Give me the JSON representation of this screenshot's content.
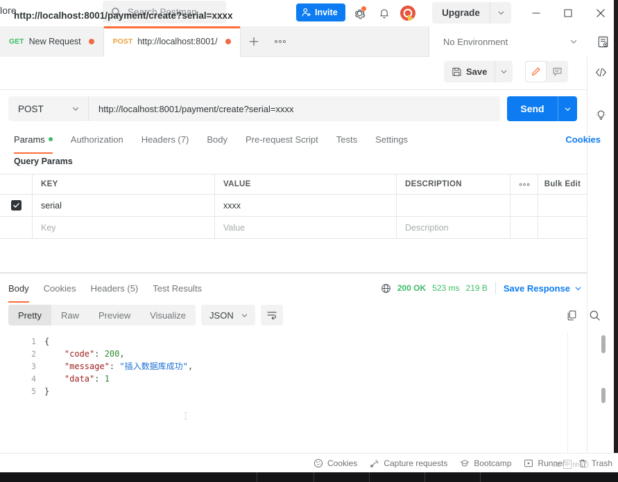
{
  "topbar": {
    "explore_label": "lore",
    "search": {
      "placeholder": "Search Postman"
    },
    "invite_label": "Invite",
    "gear_icon": "gear-icon",
    "bell_icon": "bell-icon",
    "avatar_icon": "workspace-avatar",
    "upgrade_label": "Upgrade",
    "window_minimize": "minimize-icon",
    "window_maximize": "maximize-icon",
    "window_close": "close-icon"
  },
  "tabbar": {
    "tabs": [
      {
        "method": "GET",
        "title": "New Request",
        "unsaved": true,
        "active": false
      },
      {
        "method": "POST",
        "title": "http://localhost:8001/",
        "unsaved": true,
        "active": true
      }
    ],
    "new_tab_icon": "plus-icon",
    "more_icon": "ellipsis-icon",
    "environment": "No Environment",
    "env_eye_icon": "environment-quick-look-icon"
  },
  "request": {
    "name": "http://localhost:8001/payment/create?serial=xxxx",
    "save_label": "Save",
    "save_icon": "floppy-disk-icon",
    "save_caret_icon": "chevron-down-icon",
    "edit_icon": "pencil-icon",
    "comment_icon": "comment-icon",
    "method": "POST",
    "url": "http://localhost:8001/payment/create?serial=xxxx",
    "send_label": "Send",
    "send_caret_icon": "chevron-down-icon",
    "tabs": [
      {
        "label": "Params",
        "dot": true,
        "active": true
      },
      {
        "label": "Authorization",
        "dot": false,
        "active": false
      },
      {
        "label": "Headers (7)",
        "dot": false,
        "active": false
      },
      {
        "label": "Body",
        "dot": false,
        "active": false
      },
      {
        "label": "Pre-request Script",
        "dot": false,
        "active": false
      },
      {
        "label": "Tests",
        "dot": false,
        "active": false
      },
      {
        "label": "Settings",
        "dot": false,
        "active": false
      }
    ],
    "cookies_link": "Cookies"
  },
  "params": {
    "section_label": "Query Params",
    "columns": [
      "KEY",
      "VALUE",
      "DESCRIPTION"
    ],
    "options_icon": "ellipsis-icon",
    "bulk_edit_label": "Bulk Edit",
    "rows": [
      {
        "checked": true,
        "key": "serial",
        "value": "xxxx",
        "description": ""
      }
    ],
    "new_row": {
      "key_placeholder": "Key",
      "value_placeholder": "Value",
      "description_placeholder": "Description"
    }
  },
  "response": {
    "tabs": [
      {
        "label": "Body",
        "active": true
      },
      {
        "label": "Cookies",
        "active": false
      },
      {
        "label": "Headers (5)",
        "active": false
      },
      {
        "label": "Test Results",
        "active": false
      }
    ],
    "globe_icon": "globe-icon",
    "status": "200 OK",
    "time": "523 ms",
    "size": "219 B",
    "save_response_label": "Save Response",
    "save_response_caret": "chevron-down-icon",
    "view_modes": [
      {
        "label": "Pretty",
        "active": true
      },
      {
        "label": "Raw",
        "active": false
      },
      {
        "label": "Preview",
        "active": false
      },
      {
        "label": "Visualize",
        "active": false
      }
    ],
    "format": "JSON",
    "format_caret": "chevron-down-icon",
    "wrap_icon": "word-wrap-icon",
    "copy_icon": "copy-icon",
    "search_icon": "search-icon",
    "body_lines": [
      {
        "n": "1",
        "tokens": [
          {
            "t": "{",
            "c": "pun"
          }
        ]
      },
      {
        "n": "2",
        "tokens": [
          {
            "t": "    \"code\"",
            "c": "str"
          },
          {
            "t": ": ",
            "c": "pun"
          },
          {
            "t": "200",
            "c": "num"
          },
          {
            "t": ",",
            "c": "pun"
          }
        ]
      },
      {
        "n": "3",
        "tokens": [
          {
            "t": "    \"message\"",
            "c": "str"
          },
          {
            "t": ": ",
            "c": "pun"
          },
          {
            "t": "\"插入数据库成功\"",
            "c": "cn"
          },
          {
            "t": ",",
            "c": "pun"
          }
        ]
      },
      {
        "n": "4",
        "tokens": [
          {
            "t": "    \"data\"",
            "c": "str"
          },
          {
            "t": ": ",
            "c": "pun"
          },
          {
            "t": "1",
            "c": "num"
          }
        ]
      },
      {
        "n": "5",
        "tokens": [
          {
            "t": "}",
            "c": "pun"
          }
        ]
      }
    ]
  },
  "rail": {
    "code_icon": "code-snippet-icon",
    "bulb_icon": "lightbulb-icon"
  },
  "statusbar": {
    "items": [
      {
        "label": "Cookies",
        "icon": "cookie-icon"
      },
      {
        "label": "Capture requests",
        "icon": "satellite-icon"
      },
      {
        "label": "Bootcamp",
        "icon": "graduation-cap-icon"
      },
      {
        "label": "Runner",
        "icon": "runner-icon"
      },
      {
        "label": "Trash",
        "icon": "trash-icon"
      }
    ],
    "overlay": {
      "text_left": "SD",
      "text_right": "hh",
      "help_icon": "help-icon"
    }
  },
  "colors": {
    "accent_orange": "#ff6c37",
    "primary_blue": "#0d7cf2",
    "success_green": "#3dbd66",
    "method_get": "#3dbd66",
    "method_post": "#e8a33d"
  }
}
